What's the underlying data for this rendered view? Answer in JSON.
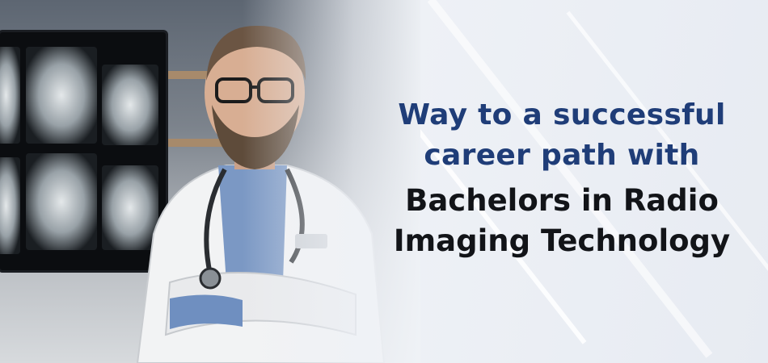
{
  "headline": {
    "line1": "Way to a successful",
    "line2": "career path with",
    "line3": "Bachelors in Radio",
    "line4": "Imaging Technology"
  },
  "colors": {
    "accent_blue": "#1f3d78",
    "dark_text": "#121418"
  }
}
